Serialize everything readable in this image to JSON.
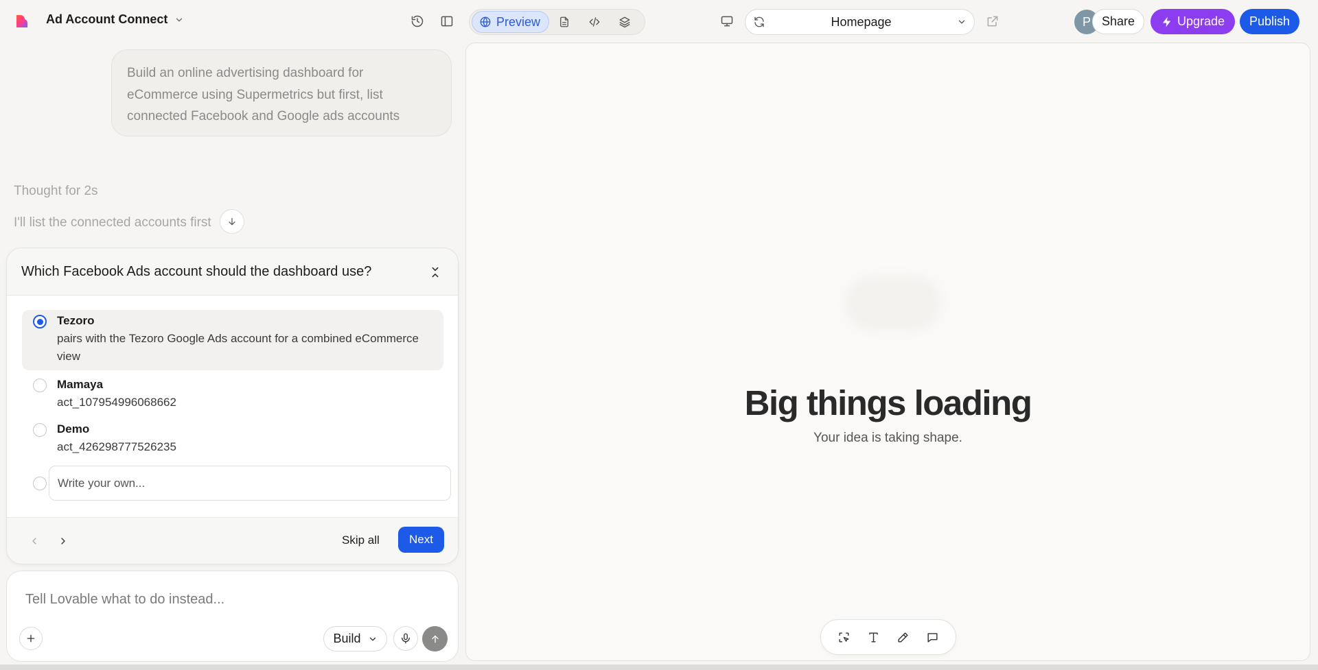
{
  "header": {
    "project_title": "Ad Account Connect",
    "view_tabs": {
      "preview_label": "Preview"
    },
    "page_selector": {
      "value": "Homepage"
    },
    "avatar_initial": "P",
    "share_label": "Share",
    "upgrade_label": "Upgrade",
    "publish_label": "Publish"
  },
  "chat": {
    "user_message": "Build an online advertising dashboard for eCommerce using Supermetrics but first, list connected Facebook and Google ads accounts",
    "thought_label": "Thought for 2s",
    "assistant_message": "I'll list the connected accounts first"
  },
  "question": {
    "title": "Which Facebook Ads account should the dashboard use?",
    "options": [
      {
        "title": "Tezoro",
        "description": "pairs with the Tezoro Google Ads account for a combined eCommerce view",
        "selected": true
      },
      {
        "title": "Mamaya",
        "description": "act_107954996068662",
        "selected": false
      },
      {
        "title": "Demo",
        "description": "act_426298777526235",
        "selected": false
      }
    ],
    "custom_placeholder": "Write your own...",
    "skip_label": "Skip all",
    "next_label": "Next"
  },
  "composer": {
    "placeholder": "Tell Lovable what to do instead...",
    "mode_label": "Build"
  },
  "preview": {
    "title": "Big things loading",
    "subtitle": "Your idea is taking shape."
  },
  "colors": {
    "accent_blue": "#1e5ae8",
    "upgrade_purple": "#8d3df0",
    "preview_tab_bg": "#dbe5fb"
  }
}
